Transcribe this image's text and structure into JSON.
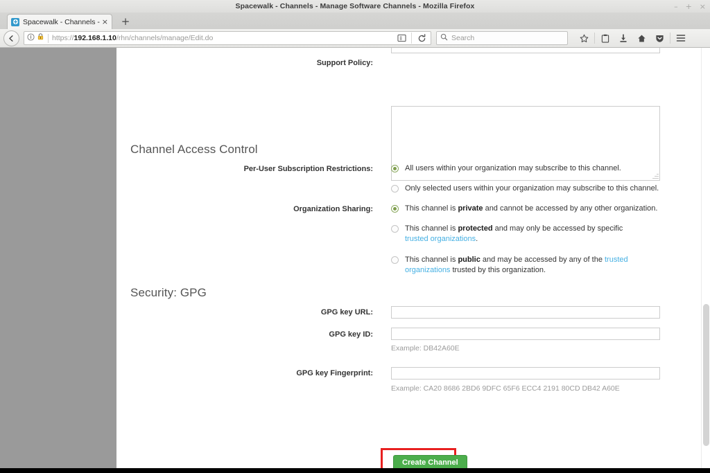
{
  "window": {
    "title": "Spacewalk - Channels - Manage Software Channels - Mozilla Firefox",
    "minimize": "–",
    "maximize": "+",
    "close": "×"
  },
  "tabs": {
    "active_title": "Spacewalk - Channels - Ma",
    "close_label": "×",
    "new_tab_label": "+"
  },
  "navbar": {
    "url_host": "192.168.1.10",
    "url_scheme": "https://",
    "url_path": "/rhn/channels/manage/Edit.do",
    "search_placeholder": "Search"
  },
  "page": {
    "top_cut_field_value": "",
    "support_policy": {
      "label": "Support Policy:",
      "value": ""
    },
    "access_control": {
      "heading": "Channel Access Control",
      "per_user_label": "Per-User Subscription Restrictions:",
      "per_user_options": [
        {
          "text_before": "All users within your organization may subscribe to this channel.",
          "checked": true
        },
        {
          "text_before": "Only selected users within your organization may subscribe to this channel.",
          "checked": false
        }
      ],
      "org_sharing_label": "Organization Sharing:",
      "org_sharing_options": [
        {
          "pre": "This channel is ",
          "strong": "private",
          "post": " and cannot be accessed by any other organization.",
          "link": "",
          "tail": "",
          "checked": true
        },
        {
          "pre": "This channel is ",
          "strong": "protected",
          "post": " and may only be accessed by specific ",
          "link": "trusted organizations",
          "tail": ".",
          "checked": false
        },
        {
          "pre": "This channel is ",
          "strong": "public",
          "post": " and may be accessed by any of the ",
          "link": "trusted organizations",
          "tail": " trusted by this organization.",
          "checked": false
        }
      ]
    },
    "security_gpg": {
      "heading": "Security: GPG",
      "key_url_label": "GPG key URL:",
      "key_url_value": "",
      "key_id_label": "GPG key ID:",
      "key_id_value": "",
      "key_id_hint": "Example: DB42A60E",
      "fingerprint_label": "GPG key Fingerprint:",
      "fingerprint_value": "",
      "fingerprint_hint": "Example: CA20 8686 2BD6 9DFC 65F6 ECC4 2191 80CD DB42 A60E"
    },
    "submit_label": "Create Channel"
  },
  "colors": {
    "button_green": "#4cae4c",
    "highlight_red": "#e82020",
    "link_blue": "#45b0e3",
    "radio_green": "#7f9e4e",
    "sidebar_gray": "#9a9a9a"
  }
}
